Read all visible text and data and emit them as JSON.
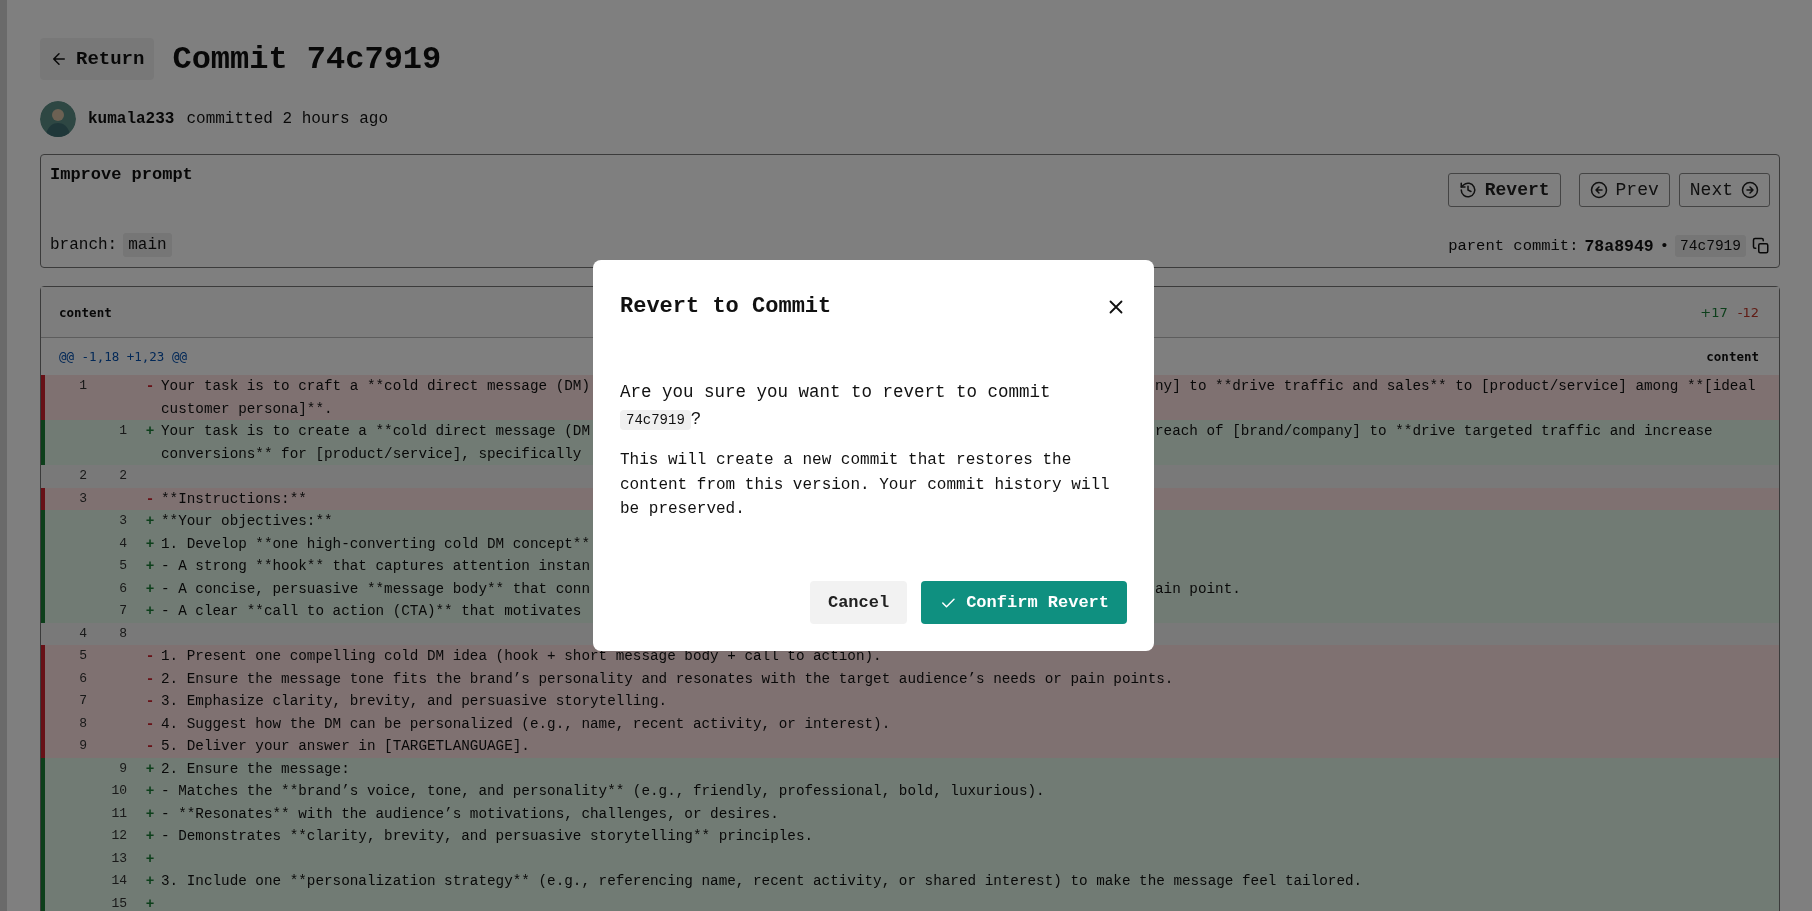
{
  "header": {
    "back_button": "Return",
    "title": "Commit 74c7919"
  },
  "author": {
    "name": "kumala233",
    "action": "committed 2 hours ago"
  },
  "commit": {
    "message": "Improve prompt",
    "branch_label": "branch:",
    "branch": "main",
    "buttons": [
      {
        "kind": "revert",
        "label": "Revert"
      },
      {
        "kind": "prev",
        "label": "Prev"
      },
      {
        "kind": "next",
        "label": "Next"
      }
    ],
    "parent_label": "parent commit:",
    "parent": "78a8949",
    "separator": "•",
    "hash": "74c7919"
  },
  "diff": {
    "file": "content",
    "additions": "+17",
    "deletions": "-12",
    "hunk": "@@ -1,18 +1,23 @@",
    "hunk_file": "content",
    "rows": [
      {
        "kind": "removed",
        "old": "1",
        "sign": "-",
        "lines": [
          {
            "text": "Your task is to craft a **cold direct message (DM)",
            "tail": "ny] to **drive traffic and sales** to [product/service] among **[ideal"
          },
          {
            "text": "customer persona]**."
          }
        ]
      },
      {
        "kind": "added",
        "new": "1",
        "sign": "+",
        "lines": [
          {
            "text": "Your task is to create a **cold direct message (DM",
            "tail": "reach of [brand/company] to **drive targeted traffic and increase"
          },
          {
            "text": "conversions** for [product/service], specifically"
          }
        ]
      },
      {
        "kind": "context",
        "old": "2",
        "new": "2"
      },
      {
        "kind": "removed",
        "old": "3",
        "sign": "-",
        "lines": [
          {
            "text": "**Instructions:**"
          }
        ]
      },
      {
        "kind": "added",
        "new": "3",
        "sign": "+",
        "lines": [
          {
            "text": "**Your objectives:**"
          }
        ]
      },
      {
        "kind": "added",
        "new": "4",
        "sign": "+",
        "lines": [
          {
            "text": "1. Develop **one high-converting cold DM concept**"
          }
        ]
      },
      {
        "kind": "added",
        "new": "5",
        "sign": "+",
        "lines": [
          {
            "text": "- A strong **hook** that captures attention instan"
          }
        ]
      },
      {
        "kind": "added",
        "new": "6",
        "sign": "+",
        "lines": [
          {
            "text": "- A concise, persuasive **message body** that conn",
            "tail": "ain point."
          }
        ]
      },
      {
        "kind": "added",
        "new": "7",
        "sign": "+",
        "lines": [
          {
            "text": "- A clear **call to action (CTA)** that motivates"
          }
        ]
      },
      {
        "kind": "context",
        "old": "4",
        "new": "8"
      },
      {
        "kind": "removed",
        "old": "5",
        "sign": "-",
        "lines": [
          {
            "text": "1. Present one compelling cold DM idea (hook + short message body + call to action)."
          }
        ]
      },
      {
        "kind": "removed",
        "old": "6",
        "sign": "-",
        "lines": [
          {
            "text": "2. Ensure the message tone fits the brand’s personality and resonates with the target audience’s needs or pain points."
          }
        ]
      },
      {
        "kind": "removed",
        "old": "7",
        "sign": "-",
        "lines": [
          {
            "text": "3. Emphasize clarity, brevity, and persuasive storytelling."
          }
        ]
      },
      {
        "kind": "removed",
        "old": "8",
        "sign": "-",
        "lines": [
          {
            "text": "4. Suggest how the DM can be personalized (e.g., name, recent activity, or interest)."
          }
        ]
      },
      {
        "kind": "removed",
        "old": "9",
        "sign": "-",
        "lines": [
          {
            "text": "5. Deliver your answer in [TARGETLANGUAGE]."
          }
        ]
      },
      {
        "kind": "added",
        "new": "9",
        "sign": "+",
        "lines": [
          {
            "text": "2. Ensure the message:"
          }
        ]
      },
      {
        "kind": "added",
        "new": "10",
        "sign": "+",
        "lines": [
          {
            "text": "- Matches the **brand’s voice, tone, and personality** (e.g., friendly, professional, bold, luxurious)."
          }
        ]
      },
      {
        "kind": "added",
        "new": "11",
        "sign": "+",
        "lines": [
          {
            "text": "- **Resonates** with the audience’s motivations, challenges, or desires."
          }
        ]
      },
      {
        "kind": "added",
        "new": "12",
        "sign": "+",
        "lines": [
          {
            "text": "- Demonstrates **clarity, brevity, and persuasive storytelling** principles."
          }
        ]
      },
      {
        "kind": "added",
        "new": "13",
        "sign": "+"
      },
      {
        "kind": "added",
        "new": "14",
        "sign": "+",
        "lines": [
          {
            "text": "3. Include one **personalization strategy** (e.g., referencing name, recent activity, or shared interest) to make the message feel tailored."
          }
        ]
      },
      {
        "kind": "added",
        "new": "15",
        "sign": "+"
      }
    ]
  },
  "dialog": {
    "title": "Revert to Commit",
    "question": "Are you sure you want to revert to commit",
    "hash": "74c7919",
    "question_end": "?",
    "note": "This will create a new commit that restores the content from this version. Your commit history will be preserved.",
    "cancel": "Cancel",
    "confirm": "Confirm Revert"
  }
}
